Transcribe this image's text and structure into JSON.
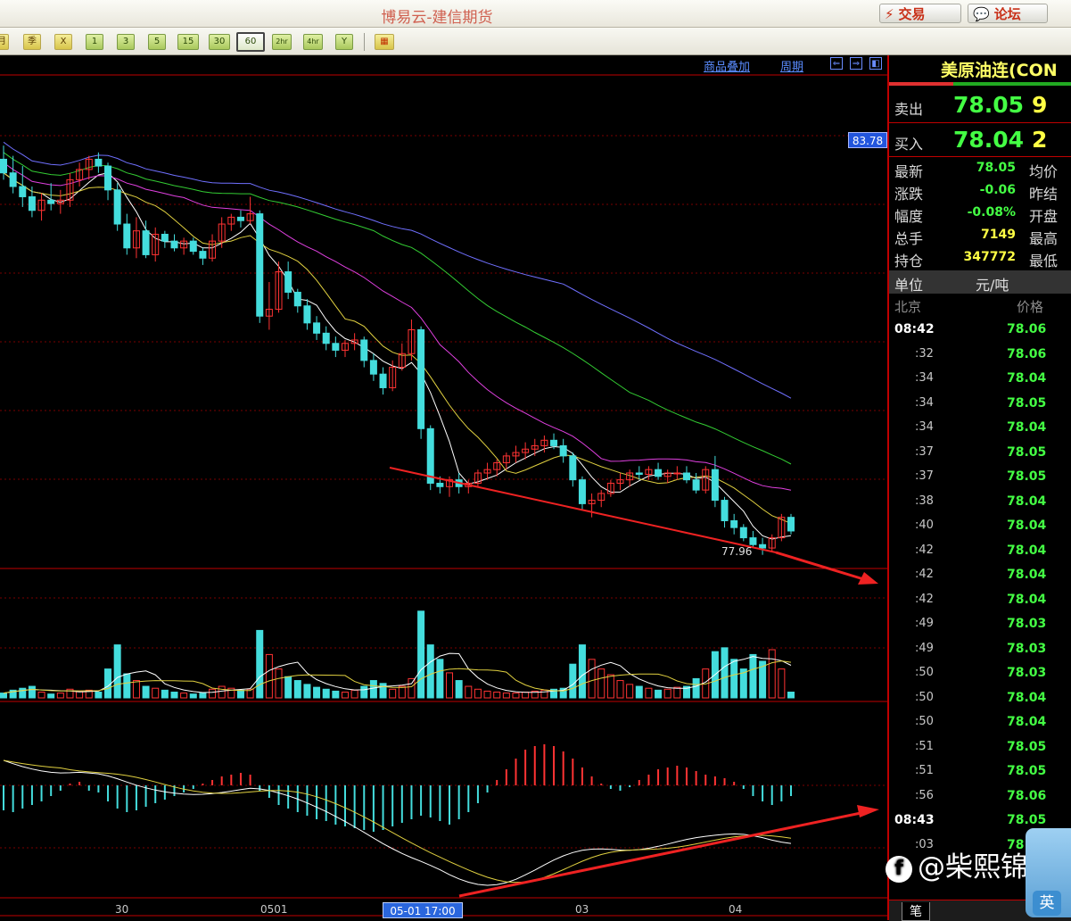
{
  "window": {
    "title": "博易云-建信期货",
    "trade_btn": "交易",
    "forum_btn": "论坛"
  },
  "toolbar": {
    "period_buttons": [
      "月",
      "季",
      "X",
      "1",
      "3",
      "5",
      "15",
      "30",
      "60",
      "2hr",
      "4hr",
      "Y"
    ],
    "selected": "60"
  },
  "chart": {
    "links": [
      "商品叠加",
      "周期"
    ],
    "price_tag": "83.78",
    "low_label": "77.96",
    "date_cursor": "05-01 17:00",
    "x_labels": [
      "30",
      "0501",
      "03",
      "04"
    ],
    "colors": {
      "up": "#ff3333",
      "down": "#44dddd",
      "ma5": "#ffffff",
      "ma10": "#e0d040",
      "ma20": "#e040e0",
      "ma40": "#33cc33",
      "ma60": "#7070ff",
      "arrow": "#ee2222"
    }
  },
  "chart_data": {
    "type": "candlestick",
    "period": "60",
    "price_range": [
      77.4,
      84.4
    ],
    "ma": [
      "ma5",
      "ma10",
      "ma20",
      "ma40",
      "ma60"
    ],
    "candles": [
      [
        83.4,
        83.6,
        83.1,
        83.2
      ],
      [
        83.2,
        83.45,
        82.9,
        83.0
      ],
      [
        83.0,
        83.3,
        82.7,
        82.85
      ],
      [
        82.85,
        83.0,
        82.55,
        82.65
      ],
      [
        82.65,
        82.9,
        82.5,
        82.8
      ],
      [
        82.8,
        83.05,
        82.65,
        82.75
      ],
      [
        82.75,
        82.95,
        82.6,
        82.8
      ],
      [
        82.8,
        83.2,
        82.7,
        83.1
      ],
      [
        83.1,
        83.35,
        83.0,
        83.25
      ],
      [
        83.25,
        83.45,
        83.1,
        83.4
      ],
      [
        83.4,
        83.5,
        83.2,
        83.3
      ],
      [
        83.3,
        83.35,
        82.8,
        82.95
      ],
      [
        82.95,
        83.05,
        82.35,
        82.45
      ],
      [
        82.45,
        82.6,
        82.0,
        82.1
      ],
      [
        82.1,
        82.55,
        81.95,
        82.35
      ],
      [
        82.35,
        82.5,
        81.95,
        82.0
      ],
      [
        82.0,
        82.4,
        81.9,
        82.3
      ],
      [
        82.3,
        82.35,
        82.1,
        82.2
      ],
      [
        82.2,
        82.3,
        82.05,
        82.1
      ],
      [
        82.1,
        82.25,
        82.0,
        82.2
      ],
      [
        82.2,
        82.25,
        82.0,
        82.05
      ],
      [
        82.05,
        82.1,
        81.85,
        81.95
      ],
      [
        81.95,
        82.3,
        81.9,
        82.2
      ],
      [
        82.2,
        82.55,
        82.1,
        82.45
      ],
      [
        82.45,
        82.6,
        82.35,
        82.55
      ],
      [
        82.55,
        82.65,
        82.4,
        82.5
      ],
      [
        82.5,
        82.85,
        82.45,
        82.6
      ],
      [
        82.6,
        82.65,
        81.0,
        81.1
      ],
      [
        81.1,
        81.6,
        80.9,
        81.2
      ],
      [
        81.2,
        81.9,
        81.15,
        81.75
      ],
      [
        81.75,
        81.9,
        81.35,
        81.45
      ],
      [
        81.45,
        81.5,
        81.15,
        81.25
      ],
      [
        81.25,
        81.35,
        80.9,
        81.0
      ],
      [
        81.0,
        81.1,
        80.75,
        80.85
      ],
      [
        80.85,
        80.95,
        80.6,
        80.7
      ],
      [
        80.7,
        80.8,
        80.5,
        80.6
      ],
      [
        80.6,
        80.75,
        80.5,
        80.7
      ],
      [
        80.7,
        80.85,
        80.6,
        80.75
      ],
      [
        80.75,
        80.8,
        80.35,
        80.45
      ],
      [
        80.45,
        80.55,
        80.15,
        80.25
      ],
      [
        80.25,
        80.35,
        79.95,
        80.05
      ],
      [
        80.05,
        80.45,
        80.0,
        80.35
      ],
      [
        80.35,
        80.7,
        80.3,
        80.55
      ],
      [
        80.55,
        81.05,
        80.45,
        80.9
      ],
      [
        80.9,
        80.95,
        79.3,
        79.45
      ],
      [
        79.45,
        79.5,
        78.55,
        78.65
      ],
      [
        78.65,
        78.75,
        78.5,
        78.6
      ],
      [
        78.6,
        78.75,
        78.45,
        78.7
      ],
      [
        78.7,
        78.8,
        78.5,
        78.6
      ],
      [
        78.6,
        78.7,
        78.5,
        78.65
      ],
      [
        78.65,
        78.85,
        78.6,
        78.8
      ],
      [
        78.8,
        78.95,
        78.7,
        78.85
      ],
      [
        78.85,
        79.0,
        78.75,
        78.95
      ],
      [
        78.95,
        79.1,
        78.85,
        79.05
      ],
      [
        79.05,
        79.2,
        78.95,
        79.1
      ],
      [
        79.1,
        79.25,
        79.0,
        79.15
      ],
      [
        79.15,
        79.3,
        79.05,
        79.2
      ],
      [
        79.2,
        79.35,
        79.1,
        79.28
      ],
      [
        79.28,
        79.38,
        79.15,
        79.2
      ],
      [
        79.2,
        79.3,
        78.95,
        79.05
      ],
      [
        79.05,
        79.1,
        78.6,
        78.7
      ],
      [
        78.7,
        78.75,
        78.25,
        78.35
      ],
      [
        78.35,
        78.5,
        78.15,
        78.4
      ],
      [
        78.4,
        78.55,
        78.3,
        78.5
      ],
      [
        78.5,
        78.7,
        78.45,
        78.65
      ],
      [
        78.65,
        78.8,
        78.55,
        78.7
      ],
      [
        78.7,
        78.85,
        78.6,
        78.8
      ],
      [
        78.8,
        78.9,
        78.7,
        78.78
      ],
      [
        78.78,
        78.9,
        78.7,
        78.85
      ],
      [
        78.85,
        78.95,
        78.7,
        78.75
      ],
      [
        78.75,
        78.85,
        78.65,
        78.8
      ],
      [
        78.8,
        78.9,
        78.7,
        78.8
      ],
      [
        78.8,
        78.9,
        78.65,
        78.7
      ],
      [
        78.7,
        78.8,
        78.5,
        78.55
      ],
      [
        78.55,
        78.9,
        78.5,
        78.85
      ],
      [
        78.85,
        79.05,
        78.3,
        78.4
      ],
      [
        78.4,
        78.45,
        78.0,
        78.1
      ],
      [
        78.1,
        78.2,
        77.9,
        78.0
      ],
      [
        78.0,
        78.05,
        77.8,
        77.85
      ],
      [
        77.85,
        77.95,
        77.7,
        77.75
      ],
      [
        77.75,
        77.85,
        77.6,
        77.7
      ],
      [
        77.7,
        77.9,
        77.65,
        77.85
      ],
      [
        77.85,
        78.2,
        77.8,
        78.15
      ],
      [
        78.15,
        78.2,
        77.9,
        77.95
      ]
    ],
    "volume": [
      5,
      8,
      10,
      12,
      6,
      4,
      5,
      9,
      7,
      8,
      6,
      30,
      55,
      25,
      18,
      12,
      10,
      8,
      6,
      5,
      4,
      5,
      9,
      12,
      10,
      8,
      9,
      70,
      45,
      30,
      22,
      18,
      14,
      11,
      9,
      7,
      6,
      8,
      12,
      18,
      15,
      9,
      12,
      20,
      90,
      55,
      40,
      26,
      18,
      12,
      9,
      7,
      6,
      5,
      5,
      6,
      7,
      8,
      9,
      10,
      35,
      55,
      40,
      30,
      24,
      18,
      14,
      12,
      10,
      8,
      9,
      11,
      12,
      20,
      30,
      48,
      52,
      40,
      30,
      45,
      38,
      50,
      30,
      6
    ],
    "macd_hist": [
      -28,
      -30,
      -26,
      -22,
      -18,
      -12,
      -6,
      2,
      4,
      -6,
      -8,
      -18,
      -26,
      -30,
      -28,
      -24,
      -20,
      -16,
      -12,
      -8,
      -4,
      2,
      6,
      10,
      12,
      14,
      12,
      -6,
      -14,
      -22,
      -26,
      -30,
      -34,
      -38,
      -40,
      -44,
      -46,
      -48,
      -50,
      -52,
      -50,
      -46,
      -42,
      -38,
      -34,
      -36,
      -40,
      -44,
      -38,
      -30,
      -20,
      -8,
      6,
      18,
      30,
      40,
      44,
      46,
      44,
      38,
      30,
      20,
      10,
      2,
      -4,
      -6,
      -2,
      6,
      12,
      18,
      20,
      22,
      20,
      16,
      12,
      10,
      8,
      4,
      -4,
      -12,
      -18,
      -22,
      -18,
      -12
    ],
    "last_price": 78.05
  },
  "quote_panel": {
    "contract": "美原油连(CON",
    "sell": {
      "label": "卖出",
      "price": "78.05",
      "qty": "9"
    },
    "buy": {
      "label": "买入",
      "price": "78.04",
      "qty": "2"
    },
    "rows": [
      {
        "label": "最新",
        "value": "78.05",
        "label2": "均价",
        "color": "#44ff44"
      },
      {
        "label": "涨跌",
        "value": "-0.06",
        "label2": "昨结",
        "color": "#44ff44"
      },
      {
        "label": "幅度",
        "value": "-0.08%",
        "label2": "开盘",
        "color": "#44ff44"
      },
      {
        "label": "总手",
        "value": "7149",
        "label2": "最高",
        "color": "#ffff44"
      },
      {
        "label": "持仓",
        "value": "347772",
        "label2": "最低",
        "color": "#ffff44"
      }
    ],
    "unit_label": "单位",
    "unit_value": "元/吨",
    "tick_header": {
      "left": "北京",
      "right": "价格"
    },
    "ticks": [
      {
        "t": "08:42",
        "p": "78.06",
        "bold": true
      },
      {
        "t": ":32",
        "p": "78.06"
      },
      {
        "t": ":34",
        "p": "78.04"
      },
      {
        "t": ":34",
        "p": "78.05"
      },
      {
        "t": ":34",
        "p": "78.04"
      },
      {
        "t": ":37",
        "p": "78.05"
      },
      {
        "t": ":37",
        "p": "78.05"
      },
      {
        "t": ":38",
        "p": "78.04"
      },
      {
        "t": ":40",
        "p": "78.04"
      },
      {
        "t": ":42",
        "p": "78.04"
      },
      {
        "t": ":42",
        "p": "78.04"
      },
      {
        "t": ":42",
        "p": "78.04"
      },
      {
        "t": ":49",
        "p": "78.03"
      },
      {
        "t": ":49",
        "p": "78.03"
      },
      {
        "t": ":50",
        "p": "78.03"
      },
      {
        "t": ":50",
        "p": "78.04"
      },
      {
        "t": ":50",
        "p": "78.04"
      },
      {
        "t": ":51",
        "p": "78.05"
      },
      {
        "t": ":51",
        "p": "78.05"
      },
      {
        "t": ":56",
        "p": "78.06"
      },
      {
        "t": "08:43",
        "p": "78.05",
        "bold": true
      },
      {
        "t": ":03",
        "p": "78"
      }
    ],
    "bottom_tab": "笔"
  },
  "watermark": {
    "logo": "f",
    "text": "@柴熙锦1"
  },
  "ime": {
    "label": "英"
  }
}
